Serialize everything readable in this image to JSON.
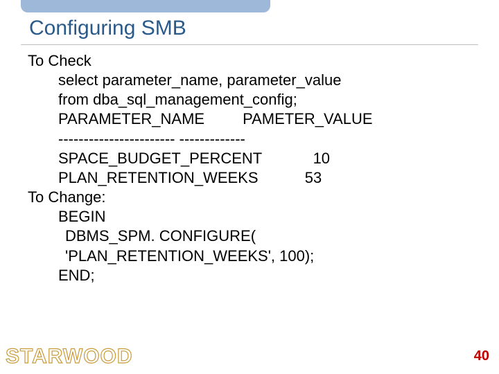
{
  "title": "Configuring SMB",
  "body": {
    "check_label": "To Check",
    "line1": "select parameter_name, parameter_value",
    "line2": "from dba_sql_management_config;",
    "header_row": "PARAMETER_NAME         PAMETER_VALUE",
    "sep_row": "----------------------- -------------",
    "row1": "SPACE_BUDGET_PERCENT            10",
    "row2": "PLAN_RETENTION_WEEKS           53",
    "change_label": "To Change:",
    "begin": "BEGIN",
    "configure": "DBMS_SPM. CONFIGURE(",
    "args": "'PLAN_RETENTION_WEEKS', 100);",
    "end": "END;"
  },
  "logo": "STARWOOD",
  "page_number": "40"
}
